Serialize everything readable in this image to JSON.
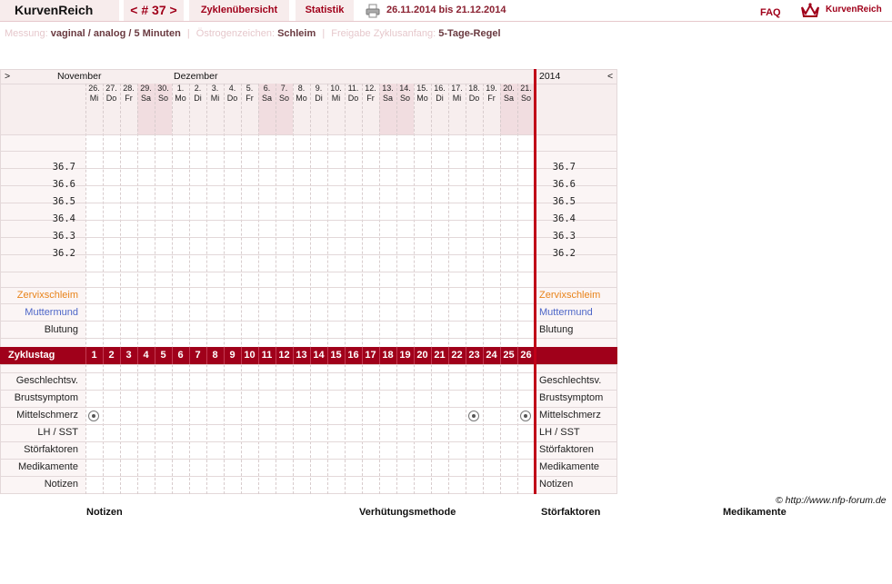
{
  "app": {
    "brand": "KurvenReich",
    "cycle_label": "< # 37 >",
    "nav_overview": "Zyklenübersicht",
    "nav_stats": "Statistik",
    "date_range": "26.11.2014 bis 21.12.2014",
    "faq": "FAQ",
    "logo_text": "KurvenReich"
  },
  "info": {
    "messung_label": "Messung:",
    "messung_value": "vaginal / analog / 5 Minuten",
    "oestrogen_label": "Östrogenzeichen:",
    "oestrogen_value": "Schleim",
    "freigabe_label": "Freigabe Zyklusanfang:",
    "freigabe_value": "5-Tage-Regel"
  },
  "chart": {
    "nav_left": ">",
    "nav_right": "<",
    "month1": "November",
    "month2": "Dezember",
    "year": "2014",
    "days": [
      {
        "d": "26.",
        "w": "Mi",
        "we": false
      },
      {
        "d": "27.",
        "w": "Do",
        "we": false
      },
      {
        "d": "28.",
        "w": "Fr",
        "we": false
      },
      {
        "d": "29.",
        "w": "Sa",
        "we": true
      },
      {
        "d": "30.",
        "w": "So",
        "we": true
      },
      {
        "d": "1.",
        "w": "Mo",
        "we": false
      },
      {
        "d": "2.",
        "w": "Di",
        "we": false
      },
      {
        "d": "3.",
        "w": "Mi",
        "we": false
      },
      {
        "d": "4.",
        "w": "Do",
        "we": false
      },
      {
        "d": "5.",
        "w": "Fr",
        "we": false
      },
      {
        "d": "6.",
        "w": "Sa",
        "we": true
      },
      {
        "d": "7.",
        "w": "So",
        "we": true
      },
      {
        "d": "8.",
        "w": "Mo",
        "we": false
      },
      {
        "d": "9.",
        "w": "Di",
        "we": false
      },
      {
        "d": "10.",
        "w": "Mi",
        "we": false
      },
      {
        "d": "11.",
        "w": "Do",
        "we": false
      },
      {
        "d": "12.",
        "w": "Fr",
        "we": false
      },
      {
        "d": "13.",
        "w": "Sa",
        "we": true
      },
      {
        "d": "14.",
        "w": "So",
        "we": true
      },
      {
        "d": "15.",
        "w": "Mo",
        "we": false
      },
      {
        "d": "16.",
        "w": "Di",
        "we": false
      },
      {
        "d": "17.",
        "w": "Mi",
        "we": false
      },
      {
        "d": "18.",
        "w": "Do",
        "we": false
      },
      {
        "d": "19.",
        "w": "Fr",
        "we": false
      },
      {
        "d": "20.",
        "w": "Sa",
        "we": true
      },
      {
        "d": "21.",
        "w": "So",
        "we": true
      }
    ],
    "temps": [
      "36.7",
      "36.6",
      "36.5",
      "36.4",
      "36.3",
      "36.2"
    ],
    "rows_top": [
      "Zervixschleim",
      "Muttermund",
      "Blutung"
    ],
    "zyklus_label": "Zyklustag",
    "zyklus_days": [
      "1",
      "2",
      "3",
      "4",
      "5",
      "6",
      "7",
      "8",
      "9",
      "10",
      "11",
      "12",
      "13",
      "14",
      "15",
      "16",
      "17",
      "18",
      "19",
      "20",
      "21",
      "22",
      "23",
      "24",
      "25",
      "26"
    ],
    "rows_bottom": [
      "Geschlechtsv.",
      "Brustsymptom",
      "Mittelschmerz",
      "LH / SST",
      "Störfaktoren",
      "Medikamente",
      "Notizen"
    ],
    "mittelschmerz_days": [
      1,
      23,
      26
    ]
  },
  "footer": {
    "copyright": "© http://www.nfp-forum.de",
    "notizen": "Notizen",
    "verhuetung": "Verhütungsmethode",
    "stoerfaktoren": "Störfaktoren",
    "medikamente": "Medikamente"
  }
}
